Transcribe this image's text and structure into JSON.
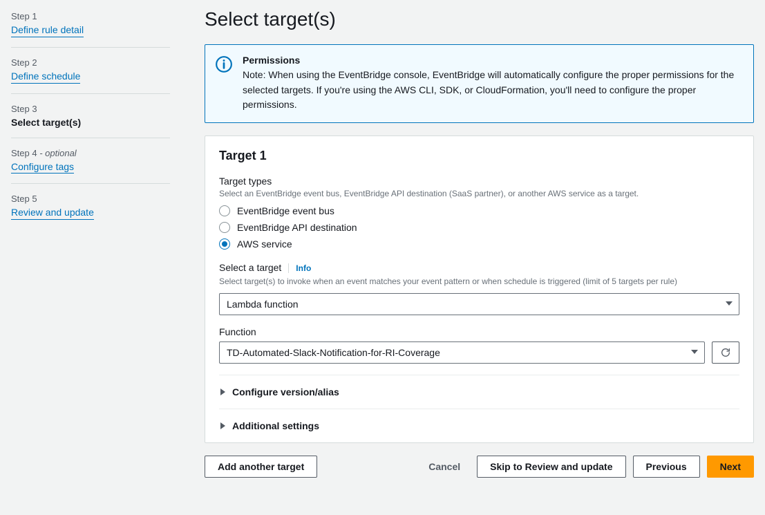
{
  "sidebar": {
    "steps": [
      {
        "num": "Step 1",
        "label": "Define rule detail"
      },
      {
        "num": "Step 2",
        "label": "Define schedule"
      },
      {
        "num": "Step 3",
        "label": "Select target(s)"
      },
      {
        "num": "Step 4",
        "optional": " - optional",
        "label": "Configure tags"
      },
      {
        "num": "Step 5",
        "label": "Review and update"
      }
    ]
  },
  "page": {
    "title": "Select target(s)"
  },
  "infobox": {
    "title": "Permissions",
    "text": "Note: When using the EventBridge console, EventBridge will automatically configure the proper permissions for the selected targets. If you're using the AWS CLI, SDK, or CloudFormation, you'll need to configure the proper permissions."
  },
  "target": {
    "heading": "Target 1",
    "types_label": "Target types",
    "types_desc": "Select an EventBridge event bus, EventBridge API destination (SaaS partner), or another AWS service as a target.",
    "options": [
      "EventBridge event bus",
      "EventBridge API destination",
      "AWS service"
    ],
    "selected_option": 2,
    "select_label": "Select a target",
    "info_link": "Info",
    "select_desc": "Select target(s) to invoke when an event matches your event pattern or when schedule is triggered (limit of 5 targets per rule)",
    "target_value": "Lambda function",
    "function_label": "Function",
    "function_value": "TD-Automated-Slack-Notification-for-RI-Coverage",
    "expand1": "Configure version/alias",
    "expand2": "Additional settings"
  },
  "footer": {
    "add": "Add another target",
    "cancel": "Cancel",
    "skip": "Skip to Review and update",
    "previous": "Previous",
    "next": "Next"
  }
}
